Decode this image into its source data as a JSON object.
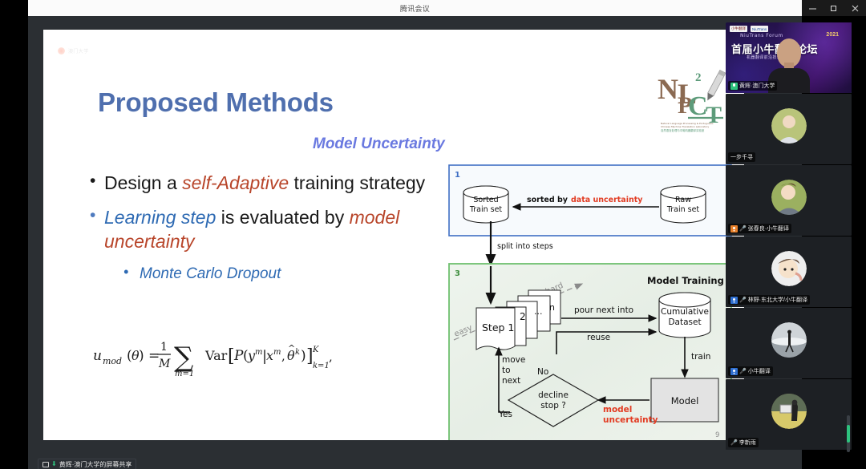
{
  "window": {
    "title": "腾讯会议",
    "controls": {
      "minimize": "−",
      "maximize": "▢",
      "close": "✕"
    }
  },
  "share_bar": {
    "label": "黄辉·澳门大学的屏幕共享"
  },
  "slide": {
    "watermark": "澳门大学",
    "title": "Proposed Methods",
    "subtitle": "Model Uncertainty",
    "page_number": "9",
    "logo": {
      "name": "NLP2CT",
      "letters": [
        "N",
        "L",
        "P",
        "2",
        "C",
        "T"
      ],
      "caption_en": "Natural Language Processing & Portuguese-Chinese Machine Translation Laboratory",
      "caption_cn": "自然语言处理与中葡机器翻译实验室"
    },
    "bullets": {
      "b1_pre": "Design a ",
      "b1_em": "self-Adaptive",
      "b1_post": " training strategy",
      "b2_em1": "Learning step",
      "b2_mid": " is evaluated by ",
      "b2_em2": "model uncertainty",
      "b3": "Monte Carlo Dropout"
    },
    "formula": {
      "lhs": "u",
      "lhs_sub": "mod",
      "lhs_arg": "(θ) =",
      "frac_num": "1",
      "frac_den": "M",
      "sum_sym": "∑",
      "sum_sub": "m=1",
      "var": "Var",
      "body": "[P(y",
      "sup_m1": "m",
      "mid": "|x",
      "sup_m2": "m",
      "theta": ", θ̂",
      "sup_k": "k",
      "close": ")]",
      "bracket_sup": "K",
      "bracket_sub": "k=1",
      "tail": ","
    },
    "diagram": {
      "box1": {
        "number": "1",
        "left_db_line1": "Sorted",
        "left_db_line2": "Train set",
        "right_db_line1": "Raw",
        "right_db_line2": "Train set",
        "edge_label_plain": "sorted by ",
        "edge_label_accent": "data uncertainty"
      },
      "connector_label": "split into steps",
      "box3": {
        "number": "3",
        "heading": "Model Training",
        "card_front": "Step 1",
        "card_2": "2",
        "card_dots": "...",
        "card_n": "n",
        "axis_easy": "easy",
        "axis_hard": "hard",
        "arrow_pour": "pour next into",
        "arrow_reuse": "reuse",
        "arrow_train": "train",
        "cumulative_line1": "Cumulative",
        "cumulative_line2": "Dataset",
        "model_box": "Model",
        "decision_line1": "decline",
        "decision_line2": "stop ?",
        "decision_no": "No",
        "decision_yes": "Yes",
        "loop_line1": "move",
        "loop_line2": "to",
        "loop_line3": "next",
        "accent_line1": "model",
        "accent_line2": "uncertainty"
      }
    }
  },
  "sidebar": {
    "tiles": [
      {
        "name": "黄辉·澳门大学",
        "type": "video",
        "speaking": true,
        "mic": "green",
        "banner": {
          "logo_a": "小牛翻译",
          "logo_b": "NiuTrans",
          "brand": "NiuTrans Forum",
          "year": "2021",
          "headline": "首届小牛翻译论坛",
          "subline": "机器翻译前沿技术与应用"
        }
      },
      {
        "name": "一步千寻",
        "type": "avatar",
        "speaking": false,
        "mic": "none"
      },
      {
        "name": "张春良·小牛翻译",
        "type": "avatar",
        "speaking": false,
        "mic": "orange"
      },
      {
        "name": "林野·东北大学/小牛翻译",
        "type": "avatar",
        "speaking": false,
        "mic": "blue"
      },
      {
        "name": "小牛翻译",
        "type": "avatar",
        "speaking": false,
        "mic": "blue"
      },
      {
        "name": "李新雨",
        "type": "avatar",
        "speaking": false,
        "mic": "none"
      }
    ]
  },
  "colors": {
    "title_blue": "#4f6fae",
    "subtitle_violet": "#6a79e0",
    "accent_red": "#b8452a",
    "accent_blue": "#2e6ab3",
    "box1_border": "#3f6fc4",
    "box3_border": "#6fc06f",
    "mic_green": "#2ec27e"
  }
}
